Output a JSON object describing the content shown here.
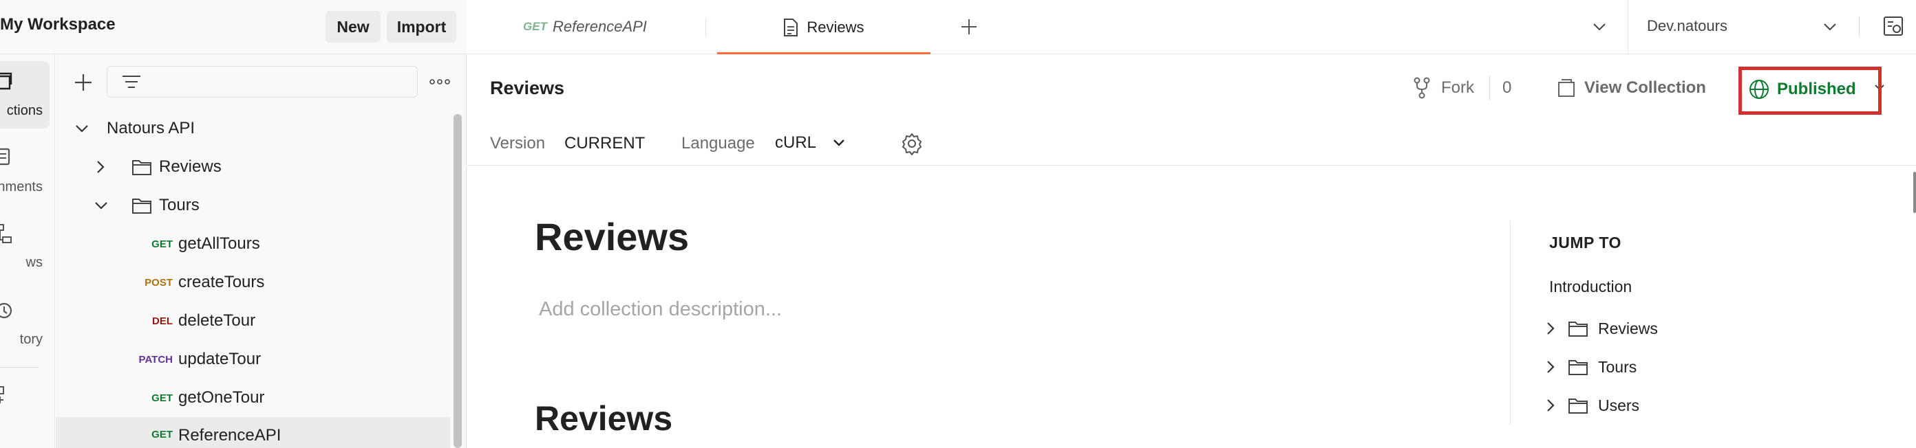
{
  "workspace": {
    "title": "My Workspace",
    "new_label": "New",
    "import_label": "Import"
  },
  "rail": [
    {
      "label": "Collections",
      "display": "ctions",
      "icon": "collections-icon",
      "active": true
    },
    {
      "label": "Environments",
      "display": "nments",
      "icon": "environments-icon"
    },
    {
      "label": "Flows",
      "display": "ws",
      "icon": "flows-icon"
    },
    {
      "label": "History",
      "display": "tory",
      "icon": "history-icon"
    },
    {
      "label": "Configure",
      "display": "",
      "icon": "add-workbench-icon"
    }
  ],
  "tree": {
    "collection": "Natours API",
    "folders": [
      {
        "name": "Reviews",
        "expanded": false
      },
      {
        "name": "Tours",
        "expanded": true
      }
    ],
    "requests": [
      {
        "method": "GET",
        "name": "getAllTours"
      },
      {
        "method": "POST",
        "name": "createTours"
      },
      {
        "method": "DEL",
        "name": "deleteTour"
      },
      {
        "method": "PATCH",
        "name": "updateTour"
      },
      {
        "method": "GET",
        "name": "getOneTour"
      },
      {
        "method": "GET",
        "name": "ReferenceAPI",
        "selected": true
      }
    ]
  },
  "tabs": [
    {
      "method": "GET",
      "label": "ReferenceAPI",
      "italic": true
    },
    {
      "label": "Reviews",
      "active": true,
      "icon": "document-icon"
    }
  ],
  "environment": {
    "selected": "Dev.natours"
  },
  "request": {
    "title": "Reviews",
    "fork_label": "Fork",
    "fork_count": "0",
    "view_collection_label": "View Collection",
    "published_label": "Published",
    "version_label": "Version",
    "version_value": "CURRENT",
    "language_label": "Language",
    "language_value": "cURL"
  },
  "doc": {
    "title": "Reviews",
    "description_placeholder": "Add collection description...",
    "section_title": "Reviews",
    "jump_to": {
      "title": "JUMP TO",
      "intro": "Introduction",
      "items": [
        "Reviews",
        "Tours",
        "Users"
      ]
    }
  },
  "colors": {
    "accent": "#ff6c37",
    "published": "#0f7a30",
    "highlight": "#d0322d"
  }
}
